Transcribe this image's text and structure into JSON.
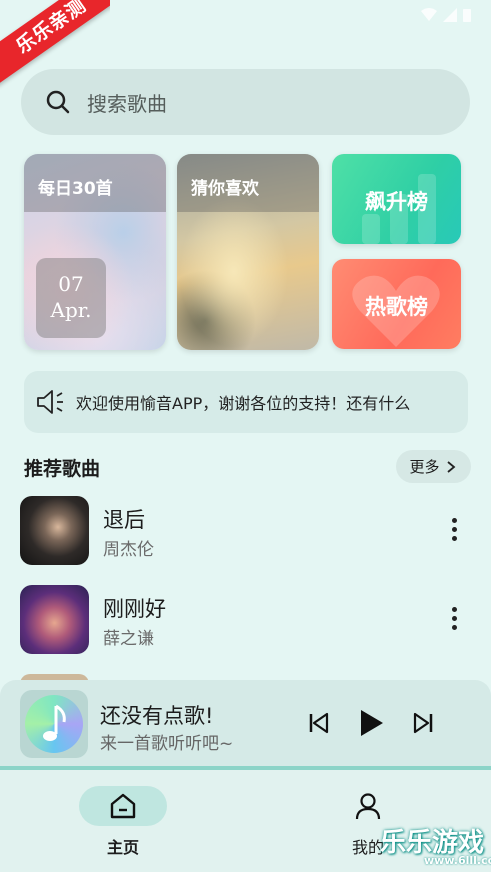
{
  "watermark": {
    "ribbon": "乐乐亲测",
    "brand": "乐乐游戏",
    "url": "www.6lll.com"
  },
  "search": {
    "placeholder": "搜索歌曲"
  },
  "cards": {
    "daily": {
      "title": "每日30首",
      "day": "07",
      "month": "Apr."
    },
    "guess": {
      "title": "猜你喜欢"
    },
    "soar": {
      "label": "飙升榜"
    },
    "hot": {
      "label": "热歌榜"
    }
  },
  "notice": {
    "text": "欢迎使用愉音APP，谢谢各位的支持！还有什么"
  },
  "recommend": {
    "title": "推荐歌曲",
    "more": "更多",
    "songs": [
      {
        "title": "退后",
        "artist": "周杰伦"
      },
      {
        "title": "刚刚好",
        "artist": "薛之谦"
      }
    ]
  },
  "player": {
    "title": "还没有点歌!",
    "subtitle": "来一首歌听听吧~"
  },
  "nav": {
    "home": "主页",
    "mine": "我的"
  },
  "colors": {
    "accent": "#bfe6e0",
    "background": "#e4f6f3",
    "soar": "#2fcfa5",
    "hot": "#ff6a5a"
  }
}
